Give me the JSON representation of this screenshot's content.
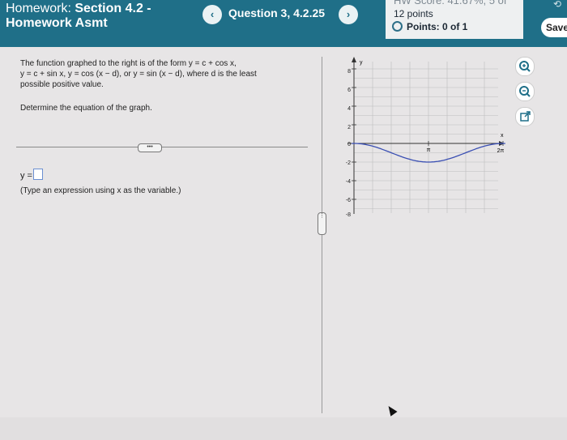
{
  "header": {
    "title_prefix": "Homework:",
    "title_bold": "Section 4.2 -",
    "title_line2": "Homework Asmt",
    "question_label": "Question 3, 4.2.25",
    "prev_icon": "‹",
    "next_icon": "›",
    "score_top": "HW Score: 41.67%, 5 of",
    "score_points": "12 points",
    "points_label": "Points: 0 of 1",
    "save_label": "Save"
  },
  "problem": {
    "line1": "The function graphed to the right is of the form y = c + cos x,",
    "line2": "y = c + sin x, y = cos (x − d), or y = sin (x − d), where d is the least",
    "line3": "possible positive value.",
    "determine": "Determine the equation of the graph.",
    "more_label": "•••",
    "answer_prefix": "y =",
    "answer_note": "(Type an expression using x as the variable.)"
  },
  "graph": {
    "y_axis_label": "y",
    "x_axis_label": "x",
    "y_ticks": [
      "8",
      "6",
      "4",
      "2",
      "0",
      "-2",
      "-4",
      "-6",
      "-8"
    ],
    "pi_label": "π",
    "two_pi_label": "2π",
    "curve_color": "#3a4fb3"
  },
  "tools": {
    "icons": [
      "zoom-in-icon",
      "zoom-out-icon",
      "popout-icon"
    ]
  }
}
